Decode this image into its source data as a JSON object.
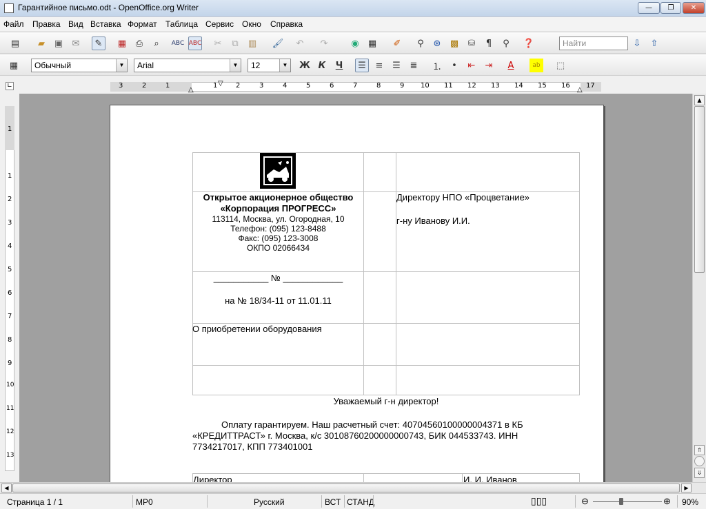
{
  "window": {
    "title": "Гарантийное письмо.odt - OpenOffice.org Writer"
  },
  "menu": [
    "Файл",
    "Правка",
    "Вид",
    "Вставка",
    "Формат",
    "Таблица",
    "Сервис",
    "Окно",
    "Справка"
  ],
  "toolbar": {
    "find_placeholder": "Найти"
  },
  "formatting": {
    "style": "Обычный",
    "font": "Arial",
    "size": "12",
    "bold": "Ж",
    "italic": "К",
    "underline": "Ч"
  },
  "ruler_labels": [
    "3",
    "2",
    "1",
    "1",
    "2",
    "3",
    "4",
    "5",
    "6",
    "7",
    "8",
    "9",
    "10",
    "11",
    "12",
    "13",
    "14",
    "15",
    "16",
    "17"
  ],
  "vruler_labels": [
    "1",
    "1",
    "2",
    "3",
    "4",
    "5",
    "6",
    "7",
    "8",
    "9",
    "10",
    "11",
    "12",
    "13"
  ],
  "document": {
    "company_line1": "Открытое акционерное общество",
    "company_line2": "«Корпорация ПРОГРЕСС»",
    "address": "113114, Москва, ул. Огородная, 10",
    "phone": "Телефон: (095) 123-8488",
    "fax": "Факс: (095) 123-3008",
    "okpo": "ОКПО 02066434",
    "recipient1": "Директору НПО «Процветание»",
    "recipient2": "г-ну Иванову И.И.",
    "number_line": "___________ № ____________",
    "ref_line": "на № 18/34-11   от 11.01.11",
    "subject": "О приобретении оборудования",
    "greeting": "Уважаемый г-н директор!",
    "body1": "Оплату гарантируем. Наш расчетный счет: 40704560100000004371 в КБ",
    "body2": "«КРЕДИТТРАСТ» г. Москва, к/с 30108760200000000743, БИК 044533743. ИНН",
    "body3": "7734217017, КПП 773401001",
    "sign_left": "Директор",
    "sign_right": "И. И. Иванов"
  },
  "status": {
    "page": "Страница  1 / 1",
    "style": "МР0",
    "lang": "Русский",
    "insert": "ВСТ",
    "mode": "СТАНД",
    "zoom": "90%"
  }
}
